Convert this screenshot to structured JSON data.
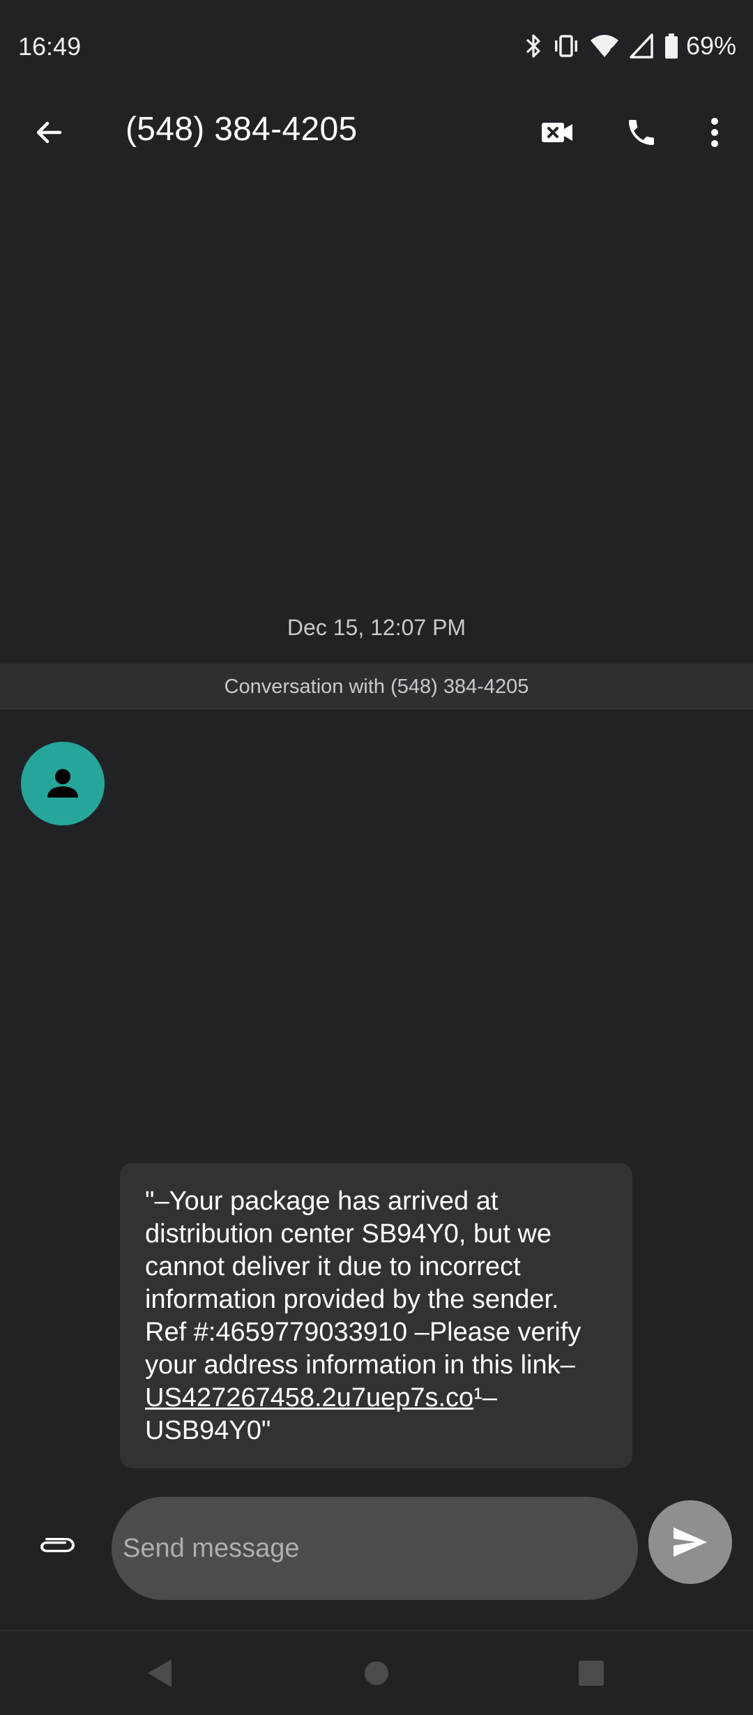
{
  "status_bar": {
    "time": "16:49",
    "battery": "69%",
    "icons": [
      "bluetooth-icon",
      "vibrate-icon",
      "wifi-icon",
      "signal-icon",
      "battery-icon"
    ]
  },
  "app_bar": {
    "title": "(548) 384-4205",
    "icons": [
      "back-arrow-icon",
      "video-call-icon",
      "phone-icon",
      "more-vert-icon"
    ]
  },
  "conversation": {
    "timestamp": "Dec 15, 12:07 PM",
    "banner": "Conversation with (548) 384-4205",
    "avatar_color": "#26a69a",
    "message": {
      "text_before_link": "\"–Your package has arrived at distribution center SB94Y0, but we cannot deliver it due to incorrect information provided by the sender. Ref #:4659779033910 –Please verify your address information in this link– ",
      "link": "US427267458.2u7uep7s.co",
      "text_after_link": "¹–USB94Y0\""
    }
  },
  "compose": {
    "placeholder": "Send message",
    "value": ""
  },
  "colors": {
    "background": "#212226",
    "bubble": "#313236",
    "compose_field": "#4b4c4f",
    "send_button": "#8e8f92"
  }
}
